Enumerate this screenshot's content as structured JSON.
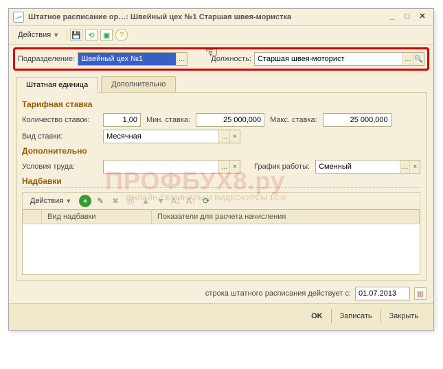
{
  "window": {
    "title": "Штатное расписание ор…: Швейный цех №1 Старшая швея-мористка"
  },
  "toolbar": {
    "actions_label": "Действия"
  },
  "filter": {
    "department_label": "Подразделение:",
    "department_value": "Швейный цех №1",
    "position_label": "Должность:",
    "position_value": "Старшая швея-моторист"
  },
  "tabs": {
    "main": "Штатная единица",
    "extra": "Дополнительно"
  },
  "tariff": {
    "title": "Тарифная ставка",
    "count_label": "Количество ставок:",
    "count_value": "1,00",
    "min_label": "Мин. ставка:",
    "min_value": "25 000,000",
    "max_label": "Макс. ставка:",
    "max_value": "25 000,000",
    "kind_label": "Вид ставки:",
    "kind_value": "Месячная"
  },
  "extra": {
    "title": "Дополнительно",
    "conditions_label": "Условия труда:",
    "conditions_value": "",
    "schedule_label": "График работы:",
    "schedule_value": "Сменный"
  },
  "allowances": {
    "title": "Надбавки",
    "actions_label": "Действия",
    "col_blank": "",
    "col_kind": "Вид надбавки",
    "col_indicators": "Показатели для расчета начисления"
  },
  "footer": {
    "valid_from_label": "строка штатного расписания действует с:",
    "valid_from_value": "01.07.2013"
  },
  "buttons": {
    "ok": "OK",
    "save": "Записать",
    "close": "Закрыть"
  },
  "watermark": {
    "main": "ПРОФБУХ8.ру",
    "sub": "ОНЛАЙН-СЕМИНАРЫ И ВИДЕОКУРСЫ 1С:8"
  }
}
